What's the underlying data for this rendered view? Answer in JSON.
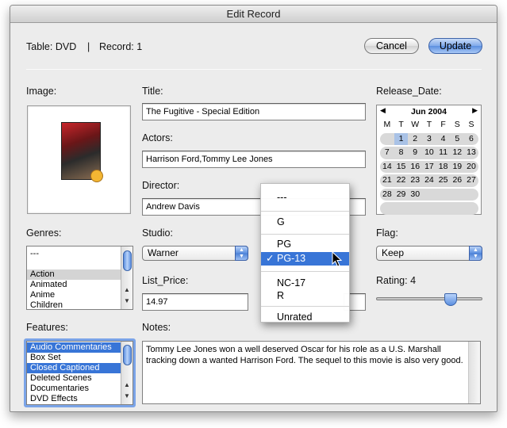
{
  "window": {
    "title": "Edit Record"
  },
  "header": {
    "table_label": "Table: DVD",
    "separator": "|",
    "record_label": "Record: 1",
    "cancel_label": "Cancel",
    "update_label": "Update"
  },
  "labels": {
    "image": "Image:",
    "title": "Title:",
    "release_date": "Release_Date:",
    "actors": "Actors:",
    "director": "Director:",
    "genres": "Genres:",
    "studio": "Studio:",
    "flag": "Flag:",
    "list_price": "List_Price:",
    "rating": "Rating: 4",
    "features": "Features:",
    "notes": "Notes:"
  },
  "fields": {
    "title": "The Fugitive - Special Edition",
    "actors": "Harrison Ford,Tommy Lee Jones",
    "director": "Andrew Davis",
    "list_price": "14.97",
    "studio": "Warner",
    "flag": "Keep",
    "notes": "Tommy Lee Jones won a well deserved Oscar for his role as a U.S. Marshall tracking down a wanted Harrison Ford. The sequel to this movie is also very good."
  },
  "genres": {
    "items": [
      "---",
      "",
      "Action",
      "Animated",
      "Anime",
      "Children"
    ],
    "highlighted": "Action"
  },
  "features": {
    "items": [
      "Audio Commentaries",
      "Box Set",
      "Closed Captioned",
      "Deleted Scenes",
      "Documentaries",
      "DVD Effects"
    ],
    "selected": [
      "Audio Commentaries",
      "Closed Captioned"
    ]
  },
  "calendar": {
    "month": "Jun 2004",
    "prev": "◀",
    "next": "▶",
    "weekdays": [
      "M",
      "T",
      "W",
      "T",
      "F",
      "S",
      "S"
    ],
    "weeks": [
      [
        "",
        "1",
        "2",
        "3",
        "4",
        "5",
        "6"
      ],
      [
        "7",
        "8",
        "9",
        "10",
        "11",
        "12",
        "13"
      ],
      [
        "14",
        "15",
        "16",
        "17",
        "18",
        "19",
        "20"
      ],
      [
        "21",
        "22",
        "23",
        "24",
        "25",
        "26",
        "27"
      ],
      [
        "28",
        "29",
        "30",
        "",
        "",
        "",
        ""
      ]
    ],
    "today": "1"
  },
  "rating": {
    "value": 4,
    "max": 5
  },
  "rating_menu": {
    "items": [
      "---",
      "G",
      "PG",
      "PG-13",
      "NC-17",
      "R",
      "Unrated"
    ],
    "selected": "PG-13",
    "check": "✓"
  },
  "colors": {
    "accent": "#3875d7",
    "highlight": "#d4d4d4"
  }
}
